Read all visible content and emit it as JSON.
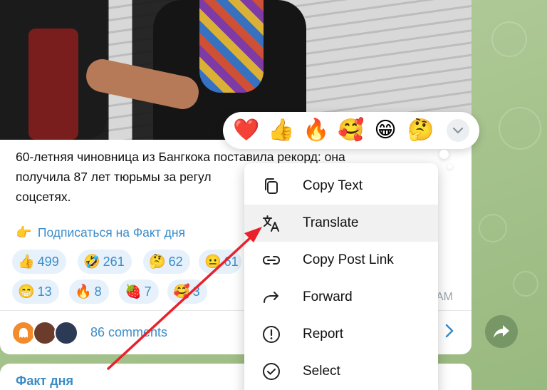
{
  "post": {
    "caption": "60-летняя чиновница из Бангкока поставила рекорд: она получила 87 лет тюрьмы за регул… соцсетях.",
    "caption_line1": "60-летняя чиновница из Бангкока поставила рекорд: она",
    "caption_line2": "получила 87 лет тюрьмы за регул",
    "caption_line3": "соцсетях.",
    "subscribe_emoji": "👉",
    "subscribe_text": "Подписаться на Факт дня",
    "time": "AM",
    "comments_label": "86 comments",
    "reactions": [
      {
        "emoji": "👍",
        "count": "499"
      },
      {
        "emoji": "🤣",
        "count": "261"
      },
      {
        "emoji": "🤔",
        "count": "62"
      },
      {
        "emoji": "😐",
        "count": "61"
      },
      {
        "emoji": "😁",
        "count": "13"
      },
      {
        "emoji": "🔥",
        "count": "8"
      },
      {
        "emoji": "🍓",
        "count": "7"
      },
      {
        "emoji": "🥰",
        "count": "3"
      }
    ]
  },
  "emoji_bar": {
    "emojis": [
      "❤️",
      "👍",
      "🔥",
      "🥰",
      "😁",
      "🤔"
    ],
    "more_icon": "chevron-down-icon"
  },
  "context_menu": {
    "items": [
      {
        "label": "Copy Text",
        "icon": "copy-icon"
      },
      {
        "label": "Translate",
        "icon": "translate-icon"
      },
      {
        "label": "Copy Post Link",
        "icon": "link-icon"
      },
      {
        "label": "Forward",
        "icon": "forward-icon"
      },
      {
        "label": "Report",
        "icon": "report-icon"
      },
      {
        "label": "Select",
        "icon": "select-icon"
      }
    ]
  },
  "next_post": {
    "channel": "Факт дня"
  },
  "colors": {
    "accent": "#3a8cc9",
    "annotation_arrow": "#e8212b",
    "reaction_bg": "#e6f1fb",
    "menu_hover": "#f1f1f1"
  }
}
